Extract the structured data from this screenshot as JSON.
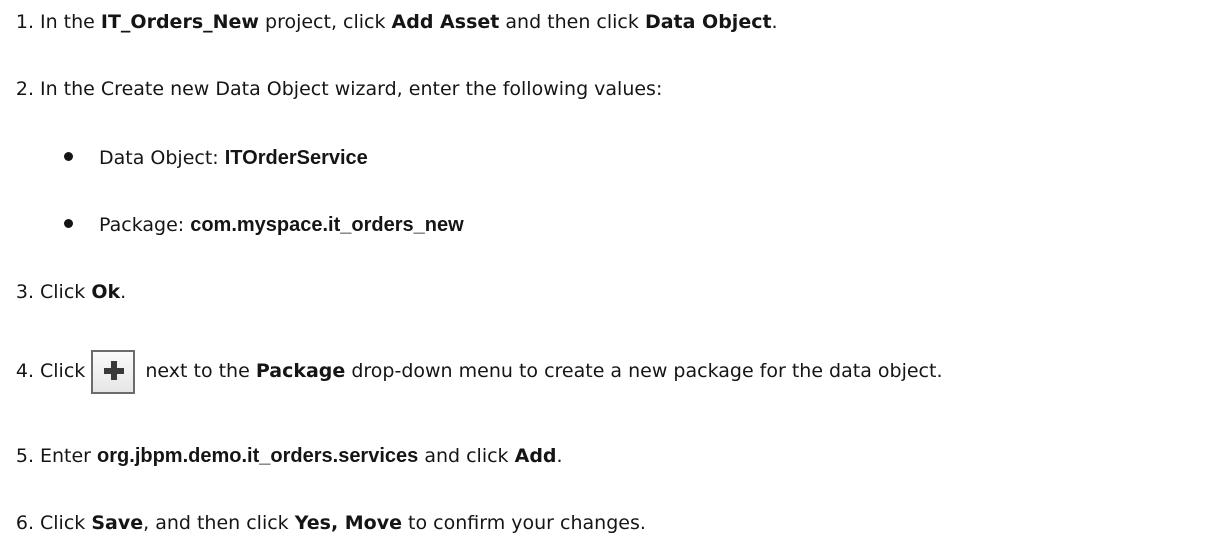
{
  "steps": [
    {
      "number": "1.",
      "t1": "In the ",
      "b1": "IT_Orders_New",
      "t2": " project, click ",
      "b2": "Add Asset",
      "t3": " and then click ",
      "b3": "Data Object",
      "t4": "."
    },
    {
      "number": "2.",
      "t1": "In the Create new Data Object wizard, enter the following values:",
      "bullets": [
        {
          "label": "Data Object: ",
          "value": "ITOrderService"
        },
        {
          "label": "Package: ",
          "value": "com.myspace.it_orders_new"
        }
      ]
    },
    {
      "number": "3.",
      "t1": "Click ",
      "b1": "Ok",
      "t2": "."
    },
    {
      "number": "4.",
      "t1": "Click ",
      "icon": "plus-icon",
      "t2": " next to the ",
      "b1": "Package",
      "t3": " drop-down menu to create a new package for the data object."
    },
    {
      "number": "5.",
      "t1": "Enter ",
      "b1": "org.jbpm.demo.it_orders.services",
      "t2": " and click ",
      "b2": "Add",
      "t3": "."
    },
    {
      "number": "6.",
      "t1": "Click ",
      "b1": "Save",
      "t2": ", and then click ",
      "b2": "Yes, Move",
      "t3": " to confirm your changes."
    }
  ]
}
